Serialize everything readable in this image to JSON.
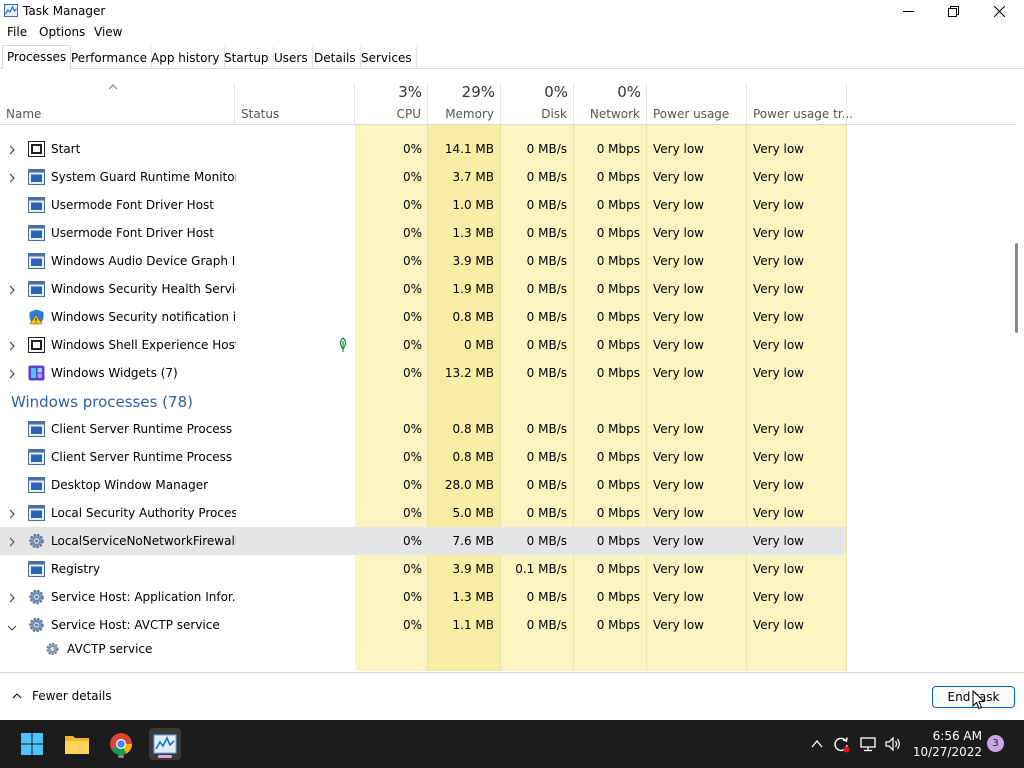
{
  "window": {
    "title": "Task Manager"
  },
  "menu": [
    "File",
    "Options",
    "View"
  ],
  "tabs": [
    "Processes",
    "Performance",
    "App history",
    "Startup",
    "Users",
    "Details",
    "Services"
  ],
  "columns": {
    "name": "Name",
    "status": "Status",
    "cpu": {
      "pct": "3%",
      "label": "CPU"
    },
    "memory": {
      "pct": "29%",
      "label": "Memory"
    },
    "disk": {
      "pct": "0%",
      "label": "Disk"
    },
    "network": {
      "pct": "0%",
      "label": "Network"
    },
    "power": "Power usage",
    "power_trend": "Power usage tr..."
  },
  "rows": [
    {
      "expand": true,
      "icon": "start-icon",
      "name": "Start",
      "status": "",
      "cpu": "0%",
      "memory": "14.1 MB",
      "disk": "0 MB/s",
      "network": "0 Mbps",
      "power": "Very low",
      "power_trend": "Very low"
    },
    {
      "expand": true,
      "icon": "process-icon",
      "name": "System Guard Runtime Monitor...",
      "status": "",
      "cpu": "0%",
      "memory": "3.7 MB",
      "disk": "0 MB/s",
      "network": "0 Mbps",
      "power": "Very low",
      "power_trend": "Very low"
    },
    {
      "expand": false,
      "icon": "process-icon",
      "name": "Usermode Font Driver Host",
      "status": "",
      "cpu": "0%",
      "memory": "1.0 MB",
      "disk": "0 MB/s",
      "network": "0 Mbps",
      "power": "Very low",
      "power_trend": "Very low"
    },
    {
      "expand": false,
      "icon": "process-icon",
      "name": "Usermode Font Driver Host",
      "status": "",
      "cpu": "0%",
      "memory": "1.3 MB",
      "disk": "0 MB/s",
      "network": "0 Mbps",
      "power": "Very low",
      "power_trend": "Very low"
    },
    {
      "expand": false,
      "icon": "process-icon",
      "name": "Windows Audio Device Graph Is...",
      "status": "",
      "cpu": "0%",
      "memory": "3.9 MB",
      "disk": "0 MB/s",
      "network": "0 Mbps",
      "power": "Very low",
      "power_trend": "Very low"
    },
    {
      "expand": true,
      "icon": "process-icon",
      "name": "Windows Security Health Service",
      "status": "",
      "cpu": "0%",
      "memory": "1.9 MB",
      "disk": "0 MB/s",
      "network": "0 Mbps",
      "power": "Very low",
      "power_trend": "Very low"
    },
    {
      "expand": false,
      "icon": "security-shield-icon",
      "name": "Windows Security notification i...",
      "status": "",
      "cpu": "0%",
      "memory": "0.8 MB",
      "disk": "0 MB/s",
      "network": "0 Mbps",
      "power": "Very low",
      "power_trend": "Very low"
    },
    {
      "expand": true,
      "icon": "start-icon",
      "name": "Windows Shell Experience Host",
      "status": "suspended-leaf-icon",
      "cpu": "0%",
      "memory": "0 MB",
      "disk": "0 MB/s",
      "network": "0 Mbps",
      "power": "Very low",
      "power_trend": "Very low"
    },
    {
      "expand": true,
      "icon": "widgets-icon",
      "name": "Windows Widgets (7)",
      "status": "",
      "cpu": "0%",
      "memory": "13.2 MB",
      "disk": "0 MB/s",
      "network": "0 Mbps",
      "power": "Very low",
      "power_trend": "Very low"
    },
    {
      "group": "Windows processes (78)"
    },
    {
      "expand": false,
      "icon": "process-icon",
      "name": "Client Server Runtime Process",
      "status": "",
      "cpu": "0%",
      "memory": "0.8 MB",
      "disk": "0 MB/s",
      "network": "0 Mbps",
      "power": "Very low",
      "power_trend": "Very low"
    },
    {
      "expand": false,
      "icon": "process-icon",
      "name": "Client Server Runtime Process",
      "status": "",
      "cpu": "0%",
      "memory": "0.8 MB",
      "disk": "0 MB/s",
      "network": "0 Mbps",
      "power": "Very low",
      "power_trend": "Very low"
    },
    {
      "expand": false,
      "icon": "process-icon",
      "name": "Desktop Window Manager",
      "status": "",
      "cpu": "0%",
      "memory": "28.0 MB",
      "disk": "0 MB/s",
      "network": "0 Mbps",
      "power": "Very low",
      "power_trend": "Very low"
    },
    {
      "expand": true,
      "icon": "process-icon",
      "name": "Local Security Authority Process...",
      "status": "",
      "cpu": "0%",
      "memory": "5.0 MB",
      "disk": "0 MB/s",
      "network": "0 Mbps",
      "power": "Very low",
      "power_trend": "Very low"
    },
    {
      "expand": true,
      "icon": "gear-icon",
      "name": "LocalServiceNoNetworkFirewall ...",
      "status": "",
      "cpu": "0%",
      "memory": "7.6 MB",
      "disk": "0 MB/s",
      "network": "0 Mbps",
      "power": "Very low",
      "power_trend": "Very low",
      "selected": true
    },
    {
      "expand": false,
      "icon": "process-icon",
      "name": "Registry",
      "status": "",
      "cpu": "0%",
      "memory": "3.9 MB",
      "disk": "0.1 MB/s",
      "network": "0 Mbps",
      "power": "Very low",
      "power_trend": "Very low"
    },
    {
      "expand": true,
      "icon": "gear-icon",
      "name": "Service Host: Application Infor...",
      "status": "",
      "cpu": "0%",
      "memory": "1.3 MB",
      "disk": "0 MB/s",
      "network": "0 Mbps",
      "power": "Very low",
      "power_trend": "Very low"
    },
    {
      "expand": "open",
      "icon": "gear-icon",
      "name": "Service Host: AVCTP service",
      "status": "",
      "cpu": "0%",
      "memory": "1.1 MB",
      "disk": "0 MB/s",
      "network": "0 Mbps",
      "power": "Very low",
      "power_trend": "Very low"
    },
    {
      "child": true,
      "icon": "gear-small-icon",
      "name": "AVCTP service"
    }
  ],
  "footer": {
    "fewer_details": "Fewer details",
    "end_task": "End task"
  },
  "taskbar": {
    "apps": [
      "windows-start-icon",
      "file-explorer-icon",
      "chrome-icon",
      "task-manager-icon"
    ],
    "time": "6:56 AM",
    "date": "10/27/2022",
    "notifications": "3"
  },
  "colors": {
    "accent": "#0067c0",
    "heat_low": "#fcf4c0",
    "heat_mid": "#f9eca4",
    "group_title": "#2f5fa7",
    "taskbar": "#1c1c1c"
  }
}
